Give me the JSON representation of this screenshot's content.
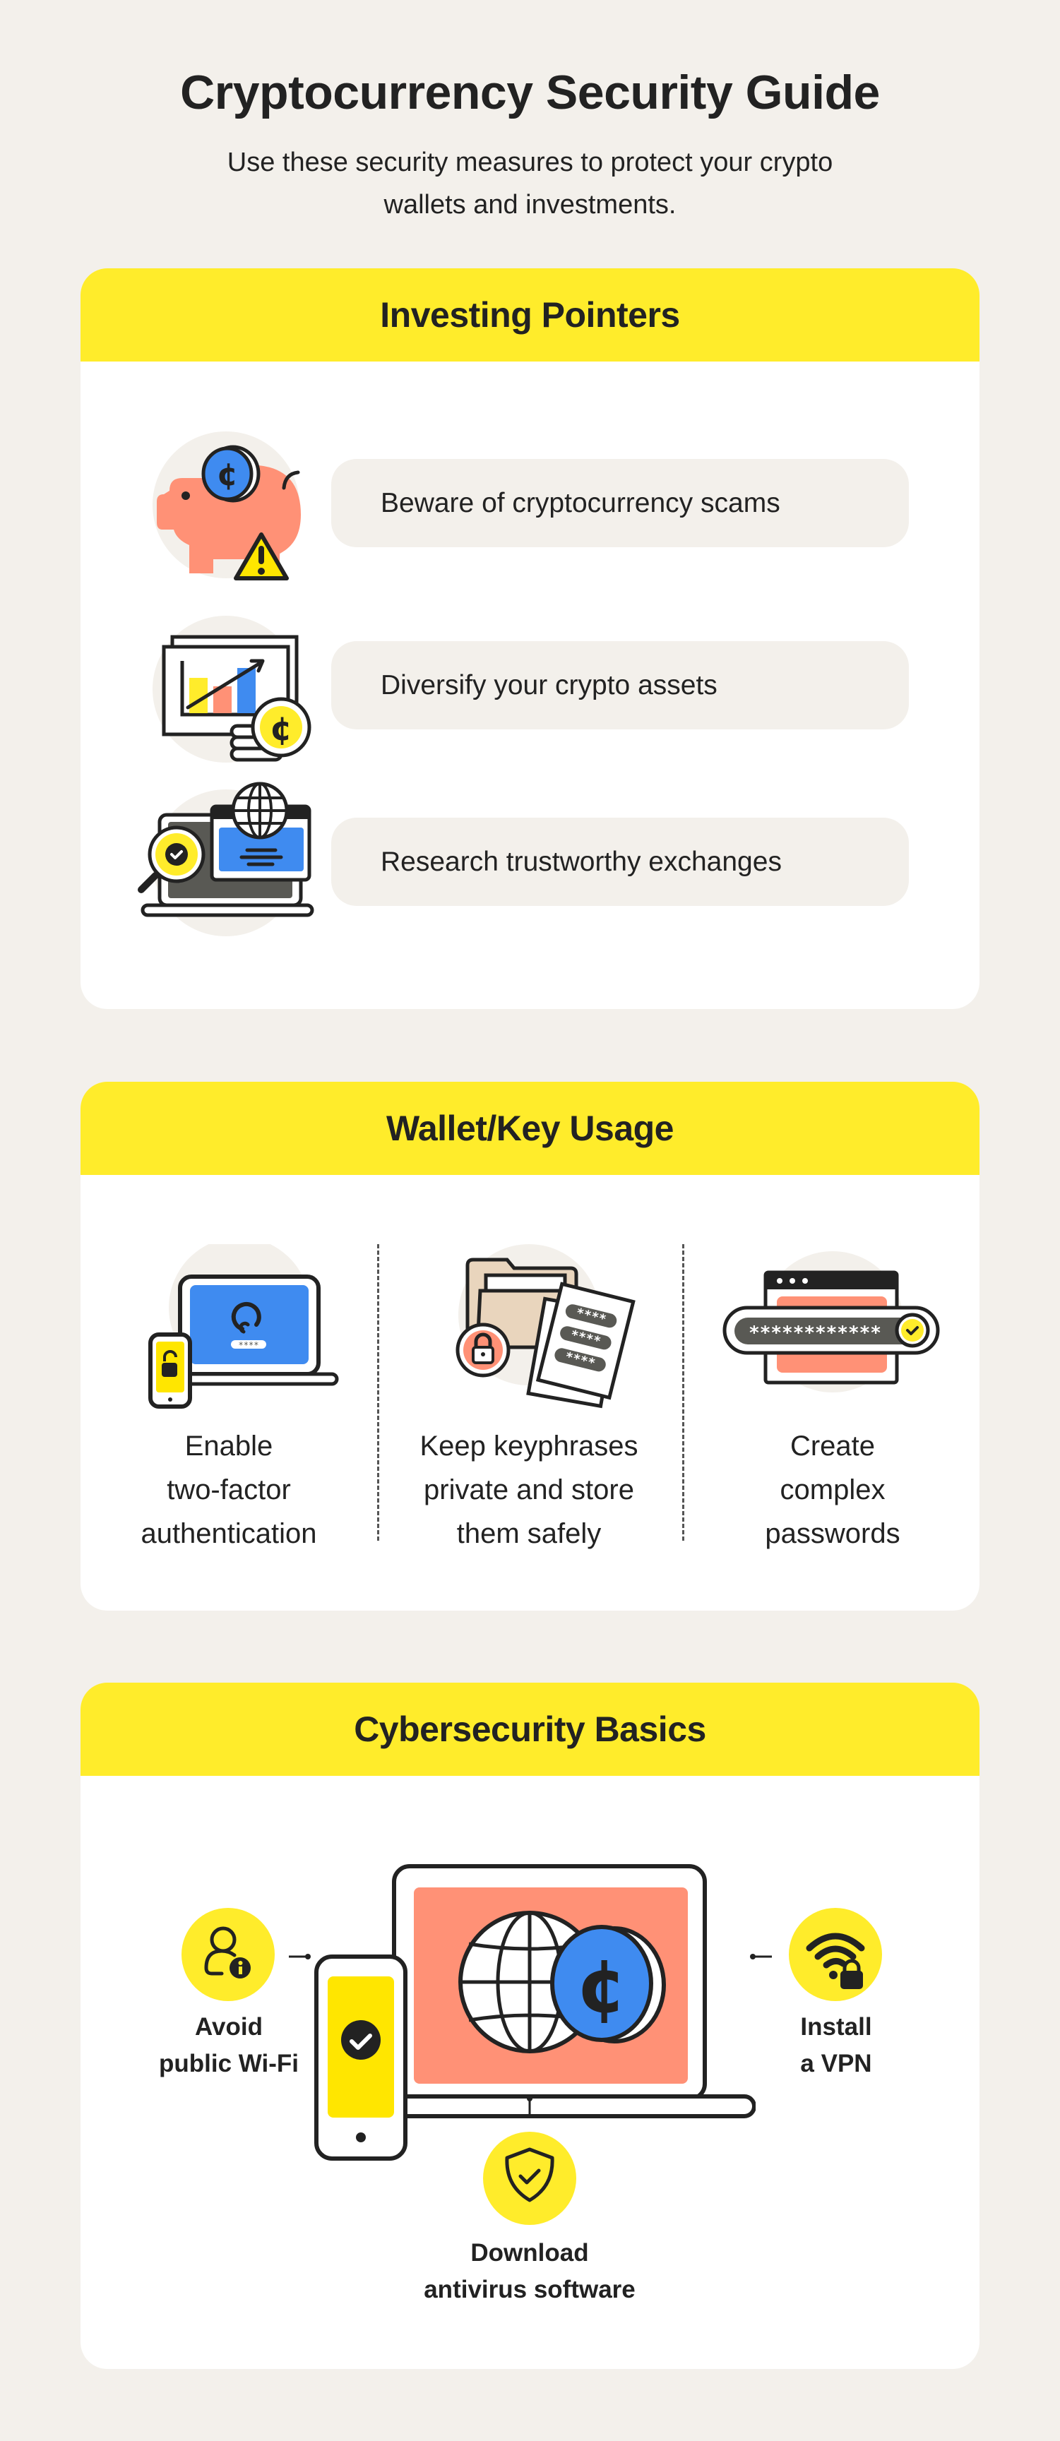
{
  "header": {
    "title": "Cryptocurrency Security Guide",
    "subtitle": "Use these security measures to protect your crypto wallets and investments."
  },
  "colors": {
    "background": "#f3f0eb",
    "accent_yellow": "#ffec2b",
    "blue": "#3f8bf0",
    "salmon": "#ff9176",
    "dark": "#222222",
    "tan": "#e9d5bd",
    "gray": "#595954"
  },
  "sections": [
    {
      "title": "Investing Pointers",
      "items": [
        {
          "label": "Beware of cryptocurrency scams",
          "icon": "piggy-bank-warning-icon"
        },
        {
          "label": "Diversify your crypto assets",
          "icon": "growth-chart-coin-icon"
        },
        {
          "label": "Research trustworthy exchanges",
          "icon": "laptop-globe-magnifier-icon"
        }
      ]
    },
    {
      "title": "Wallet/Key Usage",
      "items": [
        {
          "lines": [
            "Enable",
            "two-factor",
            "authentication"
          ],
          "icon": "two-factor-devices-icon",
          "masked_text": "****"
        },
        {
          "lines": [
            "Keep keyphrases",
            "private and store",
            "them safely"
          ],
          "icon": "locked-folder-keyphrases-icon",
          "masked_text": "****"
        },
        {
          "lines": [
            "Create",
            "complex",
            "passwords"
          ],
          "icon": "password-field-icon",
          "masked_text": "************"
        }
      ]
    },
    {
      "title": "Cybersecurity Basics",
      "center_icon": "laptop-phone-globe-coin-icon",
      "items": [
        {
          "lines": [
            "Avoid",
            "public Wi-Fi"
          ],
          "icon": "user-info-icon",
          "position": "left"
        },
        {
          "lines": [
            "Install",
            "a VPN"
          ],
          "icon": "wifi-lock-icon",
          "position": "right"
        },
        {
          "lines": [
            "Download",
            "antivirus software"
          ],
          "icon": "shield-check-icon",
          "position": "bottom"
        }
      ]
    }
  ]
}
